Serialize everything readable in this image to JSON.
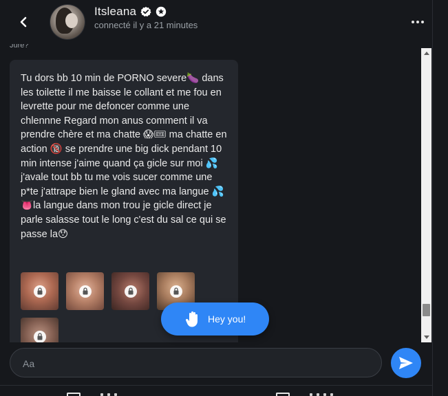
{
  "header": {
    "back_icon": "chevron-left-icon",
    "name": "Itsleana",
    "verified_icon": "verified-badge-icon",
    "creator_icon": "star-badge-icon",
    "status": "connecté il y a 21 minutes",
    "more_icon": "more-horizontal-icon"
  },
  "chat": {
    "previous_fragment": "Jure?",
    "message": "Tu dors bb 10 min de PORNO severe🍆 dans les toilette il me baisse le collant et me fou en levrette pour me defoncer comme une chlennne Regard mon anus comment il va prendre chère et ma chatte 😱🎟 ma chatte en action 🔞 se prendre une big dick pendant 10 min intense j'aime quand ça gicle sur moi 💦j'avale tout bb tu me vois sucer comme une p*te j'attrape bien le gland avec ma langue 💦👅la langue dans mon trou je gicle direct je parle salasse tout le long c'est du sal ce qui se passe la😯",
    "media": [
      {
        "icon": "lock-icon",
        "tint": "#b97a63"
      },
      {
        "icon": "lock-icon",
        "tint": "#c08a74"
      },
      {
        "icon": "lock-icon",
        "tint": "#8a5c52"
      },
      {
        "icon": "lock-icon",
        "tint": "#b08468"
      },
      {
        "icon": "lock-icon",
        "tint": "#9a7866"
      }
    ]
  },
  "hey_button": {
    "icon": "waving-hand-icon",
    "label": "Hey you!"
  },
  "composer": {
    "placeholder": "Aa",
    "value": "",
    "send_icon": "send-icon"
  },
  "colors": {
    "background": "#16181c",
    "bubble": "#24272d",
    "accent": "#2f86f6",
    "text": "#eaeaea",
    "muted": "#9aa0a6"
  }
}
